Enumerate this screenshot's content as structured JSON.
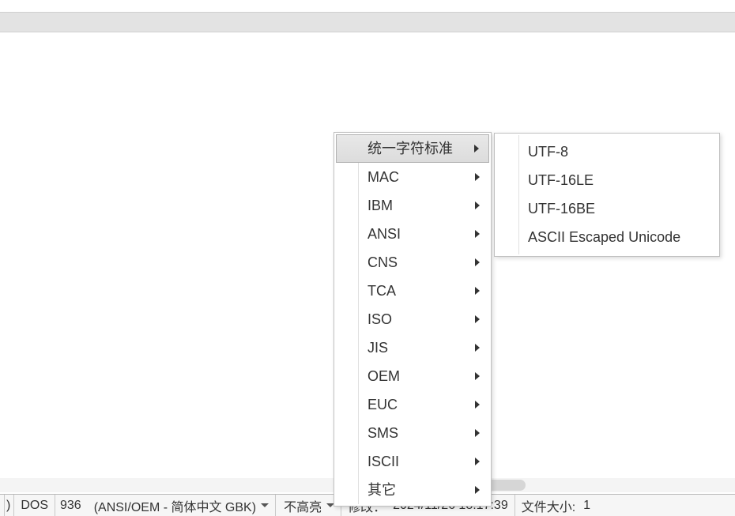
{
  "menus": {
    "main": {
      "items": [
        {
          "label": "统一字符标准",
          "hasSubmenu": true,
          "highlighted": true
        },
        {
          "label": "MAC",
          "hasSubmenu": true
        },
        {
          "label": "IBM",
          "hasSubmenu": true
        },
        {
          "label": "ANSI",
          "hasSubmenu": true
        },
        {
          "label": "CNS",
          "hasSubmenu": true
        },
        {
          "label": "TCA",
          "hasSubmenu": true
        },
        {
          "label": "ISO",
          "hasSubmenu": true
        },
        {
          "label": "JIS",
          "hasSubmenu": true
        },
        {
          "label": "OEM",
          "hasSubmenu": true
        },
        {
          "label": "EUC",
          "hasSubmenu": true
        },
        {
          "label": "SMS",
          "hasSubmenu": true
        },
        {
          "label": "ISCII",
          "hasSubmenu": true
        },
        {
          "label": "其它",
          "hasSubmenu": true
        }
      ]
    },
    "sub": {
      "items": [
        {
          "label": "UTF-8"
        },
        {
          "label": "UTF-16LE"
        },
        {
          "label": "UTF-16BE"
        },
        {
          "label": "ASCII Escaped Unicode"
        }
      ]
    }
  },
  "status": {
    "leftParen": ")",
    "lineEnding": "DOS",
    "codepage": "936",
    "encoding": "(ANSI/OEM - 简体中文 GBK)",
    "highlight": "不高亮",
    "modifiedLabel": "修改：",
    "timestamp": "2024/11/26 18:17:39",
    "filesizeLabel": "文件大小:",
    "filesizeValue": "1"
  }
}
